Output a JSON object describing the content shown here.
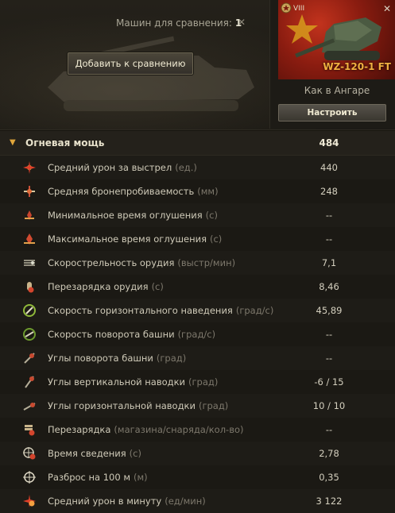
{
  "header": {
    "compare_label": "Машин для сравнения:",
    "compare_count": "1",
    "add_button": "Добавить к сравнению"
  },
  "card": {
    "tier": "VIII",
    "tank_name": "WZ-120-1 FT",
    "config_label": "Как в Ангаре",
    "setup_button": "Настроить"
  },
  "section": {
    "title": "Огневая мощь",
    "value": "484"
  },
  "rows": [
    {
      "icon": "damage-per-shot-icon",
      "label": "Средний урон за выстрел",
      "unit": "(ед.)",
      "value": "440"
    },
    {
      "icon": "penetration-icon",
      "label": "Средняя бронепробиваемость",
      "unit": "(мм)",
      "value": "248"
    },
    {
      "icon": "min-stun-icon",
      "label": "Минимальное время оглушения",
      "unit": "(с)",
      "value": "--"
    },
    {
      "icon": "max-stun-icon",
      "label": "Максимальное время оглушения",
      "unit": "(с)",
      "value": "--"
    },
    {
      "icon": "rate-of-fire-icon",
      "label": "Скорострельность орудия",
      "unit": "(выстр/мин)",
      "value": "7,1"
    },
    {
      "icon": "reload-icon",
      "label": "Перезарядка орудия",
      "unit": "(с)",
      "value": "8,46"
    },
    {
      "icon": "traverse-speed-icon",
      "label": "Скорость горизонтального наведения",
      "unit": "(град/с)",
      "value": "45,89"
    },
    {
      "icon": "turret-rotation-icon",
      "label": "Скорость поворота башни",
      "unit": "(град/с)",
      "value": "--"
    },
    {
      "icon": "turret-angles-icon",
      "label": "Углы поворота башни",
      "unit": "(град)",
      "value": "--"
    },
    {
      "icon": "vertical-angles-icon",
      "label": "Углы вертикальной наводки",
      "unit": "(град)",
      "value": "-6 / 15"
    },
    {
      "icon": "horizontal-angles-icon",
      "label": "Углы горизонтальной наводки",
      "unit": "(град)",
      "value": "10 / 10"
    },
    {
      "icon": "magazine-reload-icon",
      "label": "Перезарядка",
      "unit": "(магазина/снаряда/кол-во)",
      "value": "--"
    },
    {
      "icon": "aim-time-icon",
      "label": "Время сведения",
      "unit": "(с)",
      "value": "2,78"
    },
    {
      "icon": "dispersion-icon",
      "label": "Разброс на 100 м",
      "unit": "(м)",
      "value": "0,35"
    },
    {
      "icon": "damage-per-minute-icon",
      "label": "Средний урон в минуту",
      "unit": "(ед/мин)",
      "value": "3 122"
    }
  ]
}
